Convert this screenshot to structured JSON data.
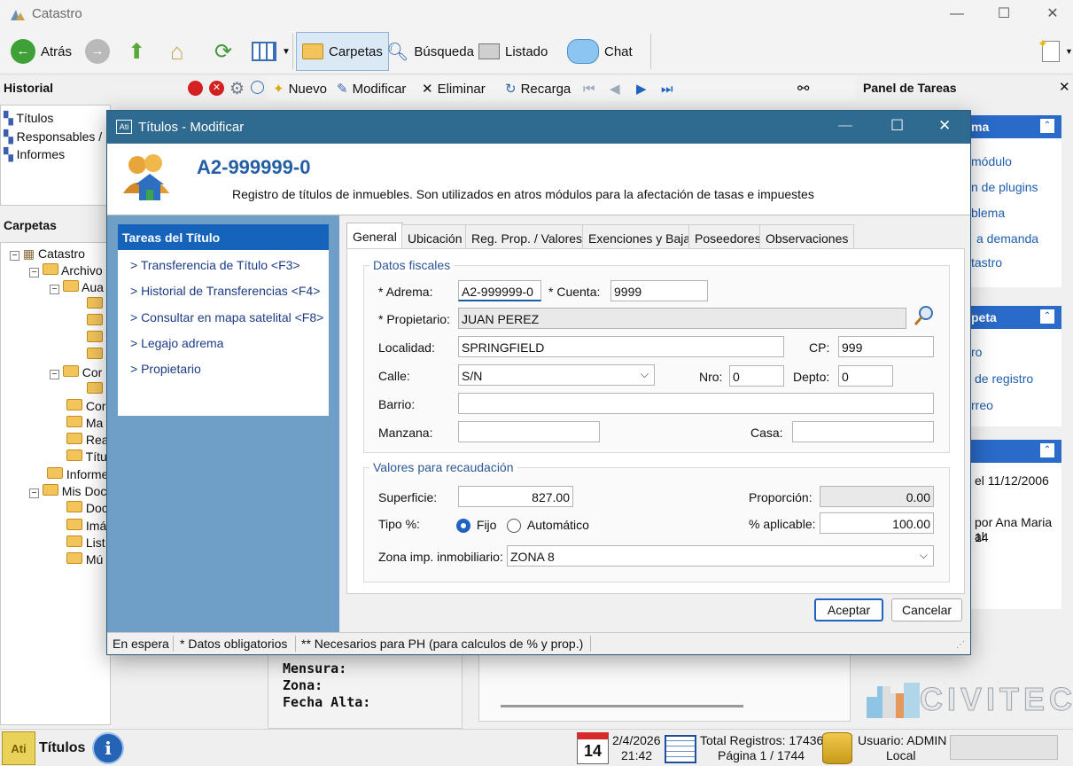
{
  "window": {
    "title": "Catastro"
  },
  "toolbar": {
    "back": "Atrás",
    "folders": "Carpetas",
    "search": "Búsqueda",
    "list": "Listado",
    "chat": "Chat"
  },
  "historial": {
    "title": "Historial",
    "items": [
      "Títulos",
      "Responsables /",
      "Informes"
    ]
  },
  "carpetas": {
    "title": "Carpetas",
    "tree": [
      "Catastro",
      "Archivo",
      "Aua",
      "",
      "",
      "",
      "",
      "Cor",
      "",
      "Cor",
      "Ma",
      "Rea",
      "Títu",
      "Informe",
      "Mis Doc",
      "Doc",
      "Imá",
      "List",
      "Mú"
    ]
  },
  "subtoolbar": {
    "new": "Nuevo",
    "modify": "Modificar",
    "delete": "Eliminar",
    "reload": "Recarga"
  },
  "tasks_panel": {
    "title": "Panel de Tareas",
    "group1": {
      "title": "ma",
      "links": [
        "módulo",
        "n de plugins",
        "blema",
        "a demanda",
        "tastro"
      ]
    },
    "group2": {
      "title": "peta",
      "links": [
        "ro",
        "de registro",
        "rreo"
      ]
    },
    "group3": {
      "lines": [
        "el 11/12/2006",
        "por Ana Maria al",
        "14"
      ]
    }
  },
  "background_detail": {
    "lines": [
      "Mensura:",
      "Zona:",
      "Fecha Alta:"
    ]
  },
  "brand": "CIVITEC",
  "statusbar": {
    "module": "Títulos",
    "day": "14",
    "date": "2/4/2026",
    "time": "21:42",
    "total": "Total Registros: 17436",
    "page": "Página 1 / 1744",
    "user": "Usuario: ADMIN",
    "location": "Local"
  },
  "dialog": {
    "title": "Títulos - Modificar",
    "record_id": "A2-999999-0",
    "description": "Registro de títulos de inmuebles. Son utilizados en atros módulos para la afectación de tasas e impuestes",
    "tasks_title": "Tareas del Título",
    "tasks": [
      "> Transferencia de Título <F3>",
      "> Historial de Transferencias <F4>",
      "> Consultar en mapa satelital <F8>",
      "> Legajo adrema",
      "> Propietario"
    ],
    "tabs": [
      "General",
      "Ubicación",
      "Reg. Prop. / Valores",
      "Exenciones y Baja",
      "Poseedores",
      "Observaciones"
    ],
    "fiscal": {
      "title": "Datos fiscales",
      "adrema_label": "* Adrema:",
      "adrema": "A2-999999-0",
      "cuenta_label": "* Cuenta:",
      "cuenta": "9999",
      "propietario_label": "* Propietario:",
      "propietario": "JUAN PEREZ",
      "localidad_label": "Localidad:",
      "localidad": "SPRINGFIELD",
      "cp_label": "CP:",
      "cp": "999",
      "calle_label": "Calle:",
      "calle": "S/N",
      "nro_label": "Nro:",
      "nro": "0",
      "depto_label": "Depto:",
      "depto": "0",
      "barrio_label": "Barrio:",
      "barrio": "",
      "manzana_label": "Manzana:",
      "manzana": "",
      "casa_label": "Casa:",
      "casa": ""
    },
    "valores": {
      "title": "Valores para recaudación",
      "superficie_label": "Superficie:",
      "superficie": "827.00",
      "proporcion_label": "Proporción:",
      "proporcion": "0.00",
      "tipo_label": "Tipo %:",
      "fijo": "Fijo",
      "automatico": "Automático",
      "selected": "Fijo",
      "aplicable_label": "% aplicable:",
      "aplicable": "100.00",
      "zona_label": "Zona imp. inmobiliario:",
      "zona": "ZONA 8"
    },
    "accept": "Aceptar",
    "cancel": "Cancelar",
    "status": [
      "En espera",
      "* Datos obligatorios",
      "** Necesarios para PH (para calculos de % y prop.)"
    ]
  }
}
